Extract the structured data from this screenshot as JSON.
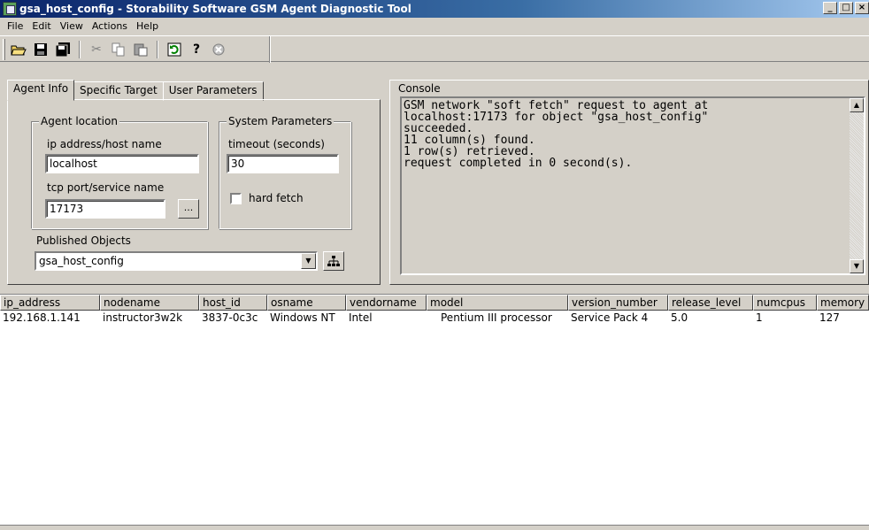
{
  "window": {
    "title": "gsa_host_config - Storability Software GSM Agent Diagnostic Tool",
    "controls": {
      "minimize": "_",
      "maximize": "□",
      "close": "×"
    }
  },
  "menu": [
    "File",
    "Edit",
    "View",
    "Actions",
    "Help"
  ],
  "toolbar": {
    "buttons": [
      "open-icon",
      "save-icon",
      "save-all-icon",
      "cut-icon",
      "copy-icon",
      "paste-icon",
      "refresh-icon",
      "help-icon",
      "stop-icon"
    ]
  },
  "tabs": [
    "Agent Info",
    "Specific Target",
    "User Parameters"
  ],
  "agent_location": {
    "legend": "Agent location",
    "ip_label": "ip address/host name",
    "ip_value": "localhost",
    "port_label": "tcp port/service name",
    "port_value": "17173",
    "browse_label": "..."
  },
  "system_parameters": {
    "legend": "System Parameters",
    "timeout_label": "timeout (seconds)",
    "timeout_value": "30",
    "hard_fetch_label": "hard fetch",
    "hard_fetch_checked": false
  },
  "published_objects": {
    "label": "Published Objects",
    "selected": "gsa_host_config"
  },
  "console": {
    "label": "Console",
    "text": "GSM network \"soft fetch\" request to agent at\nlocalhost:17173 for object \"gsa_host_config\"\nsucceeded.\n11 column(s) found.\n1 row(s) retrieved.\nrequest completed in 0 second(s)."
  },
  "results": {
    "columns": [
      "ip_address",
      "nodename",
      "host_id",
      "osname",
      "vendorname",
      "model",
      "version_number",
      "release_level",
      "numcpus",
      "memory"
    ],
    "rows": [
      [
        "192.168.1.141",
        "instructor3w2k",
        "3837-0c3c",
        "Windows NT",
        "Intel",
        "Pentium III processor",
        "Service Pack 4",
        "5.0",
        "1",
        "127"
      ]
    ]
  }
}
